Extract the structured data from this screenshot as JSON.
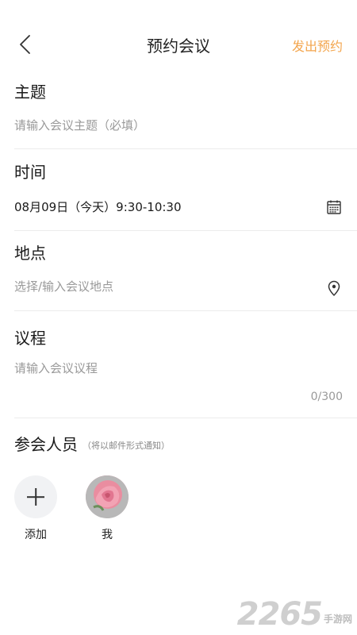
{
  "header": {
    "title": "预约会议",
    "action_label": "发出预约",
    "back_icon": "chevron-left-icon"
  },
  "topic": {
    "label": "主题",
    "placeholder": "请输入会议主题（必填）"
  },
  "time": {
    "label": "时间",
    "value": "08月09日（今天）9:30-10:30",
    "icon": "calendar-icon"
  },
  "location": {
    "label": "地点",
    "placeholder": "选择/输入会议地点",
    "icon": "location-pin-icon"
  },
  "agenda": {
    "label": "议程",
    "placeholder": "请输入会议议程",
    "counter": "0/300"
  },
  "participants": {
    "label": "参会人员",
    "hint": "（将以邮件形式通知）",
    "add_label": "添加",
    "people": [
      {
        "name": "我"
      }
    ]
  },
  "watermark": {
    "number": "2265",
    "text": "手游网"
  },
  "colors": {
    "accent": "#f3a54d",
    "divider": "#ececec",
    "placeholder": "#999999"
  }
}
